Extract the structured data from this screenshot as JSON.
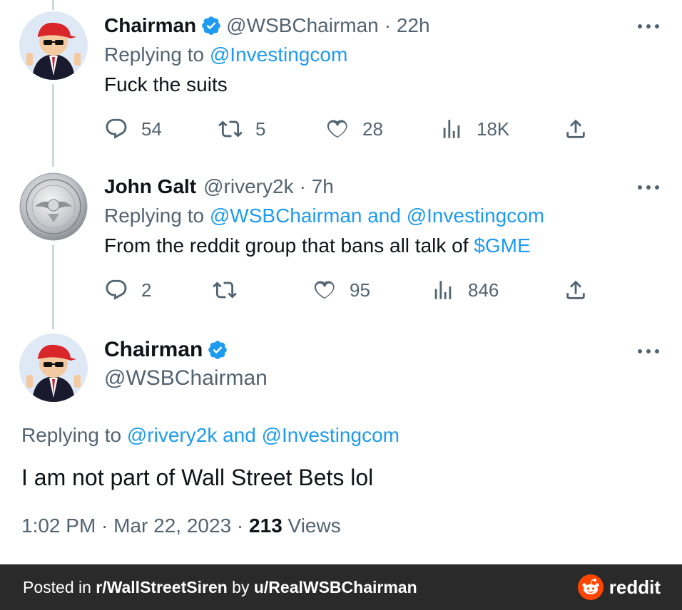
{
  "tweets": [
    {
      "name": "Chairman",
      "verified": true,
      "handle": "@WSBChairman",
      "time": "· 22h",
      "replying_prefix": "Replying to ",
      "replying_to": "@Investingcom",
      "text": "Fuck the suits",
      "stats": {
        "replies": "54",
        "retweets": "5",
        "likes": "28",
        "views": "18K"
      }
    },
    {
      "name": "John Galt",
      "handle": "@rivery2k",
      "time": "· 7h",
      "replying_prefix": "Replying to ",
      "replying_to": "@WSBChairman and @Investingcom",
      "text": "From the reddit group that bans all talk of ",
      "text_link": "$GME",
      "stats": {
        "replies": "2",
        "retweets": "",
        "likes": "95",
        "views": "846"
      }
    }
  ],
  "main_tweet": {
    "name": "Chairman",
    "verified": true,
    "handle": "@WSBChairman",
    "replying_prefix": "Replying to ",
    "replying_to": "@rivery2k and @Investingcom",
    "text": "I am not part of Wall Street Bets lol",
    "timestamp": "1:02 PM · Mar 22, 2023 · ",
    "views_count": "213",
    "views_label": " Views"
  },
  "footer": {
    "posted_in_prefix": "Posted in ",
    "subreddit": "r/WallStreetSiren",
    "by_prefix": " by ",
    "user": "u/RealWSBChairman",
    "brand": "reddit"
  },
  "colors": {
    "link": "#1d9bf0",
    "secondary_text": "#536471",
    "footer_bg": "#2a2a2a",
    "reddit_orange": "#ff4500"
  },
  "icons": [
    "reply-icon",
    "retweet-icon",
    "like-icon",
    "views-icon",
    "share-icon",
    "verified-badge-icon",
    "more-icon",
    "reddit-logo-icon"
  ]
}
